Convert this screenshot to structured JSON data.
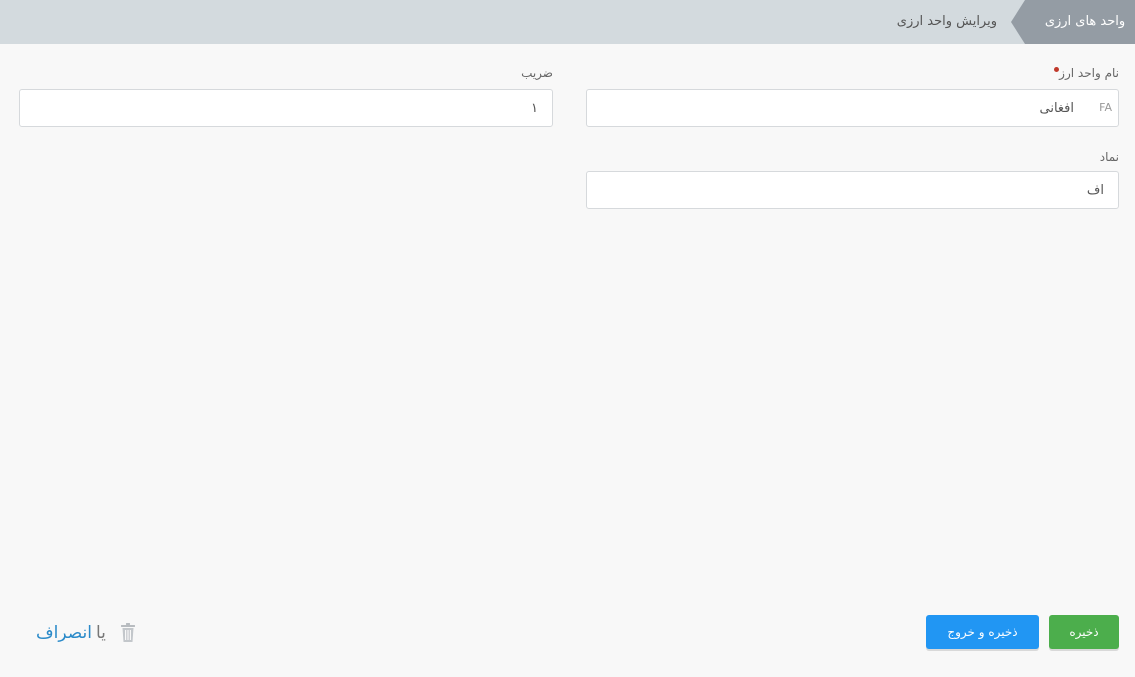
{
  "breadcrumb": {
    "root": "واحد های ارزی",
    "current": "ویرایش واحد ارزی"
  },
  "form": {
    "currency_name": {
      "label": "نام واحد ارز",
      "required": true,
      "lang_tag": "FA",
      "value": "افغانی"
    },
    "multiplier": {
      "label": "ضریب",
      "value": "۱"
    },
    "symbol": {
      "label": "نماد",
      "value": "اف"
    }
  },
  "actions": {
    "save_label": "ذخیره",
    "save_exit_label": "ذخیره و خروج",
    "or_text": "یا",
    "cancel_label": "انصراف",
    "delete_icon": "trash-icon"
  },
  "colors": {
    "save": "#4cae4c",
    "save_exit": "#2196f3",
    "cancel_link": "#2a8ac9",
    "required_dot": "#c0392b"
  }
}
